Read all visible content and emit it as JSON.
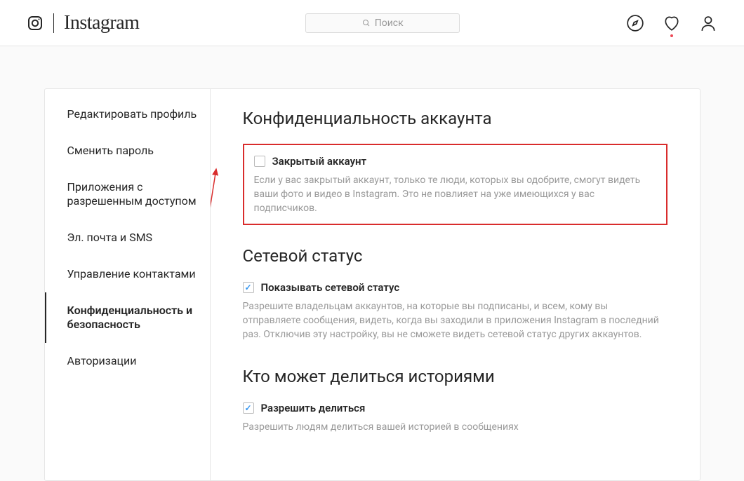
{
  "header": {
    "brand": "Instagram",
    "search_placeholder": "Поиск"
  },
  "sidebar": {
    "items": [
      {
        "label": "Редактировать профиль"
      },
      {
        "label": "Сменить пароль"
      },
      {
        "label": "Приложения с разрешенным доступом"
      },
      {
        "label": "Эл. почта и SMS"
      },
      {
        "label": "Управление контактами"
      },
      {
        "label": "Конфиденциальность и безопасность"
      },
      {
        "label": "Авторизации"
      }
    ],
    "active_index": 5
  },
  "sections": {
    "account_privacy": {
      "title": "Конфиденциальность аккаунта",
      "check_label": "Закрытый аккаунт",
      "checked": false,
      "desc": "Если у вас закрытый аккаунт, только те люди, которых вы одобрите, смогут видеть ваши фото и видео в Instagram. Это не повлияет на уже имеющихся у вас подписчиков."
    },
    "activity_status": {
      "title": "Сетевой статус",
      "check_label": "Показывать сетевой статус",
      "checked": true,
      "desc": "Разрешите владельцам аккаунтов, на которые вы подписаны, и всем, кому вы отправляете сообщения, видеть, когда вы заходили в приложения Instagram в последний раз. Отключив эту настройку, вы не сможете видеть сетевой статус других аккаунтов."
    },
    "story_sharing": {
      "title": "Кто может делиться историями",
      "check_label": "Разрешить делиться",
      "checked": true,
      "desc": "Разрешить людям делиться вашей историей в сообщениях"
    }
  }
}
